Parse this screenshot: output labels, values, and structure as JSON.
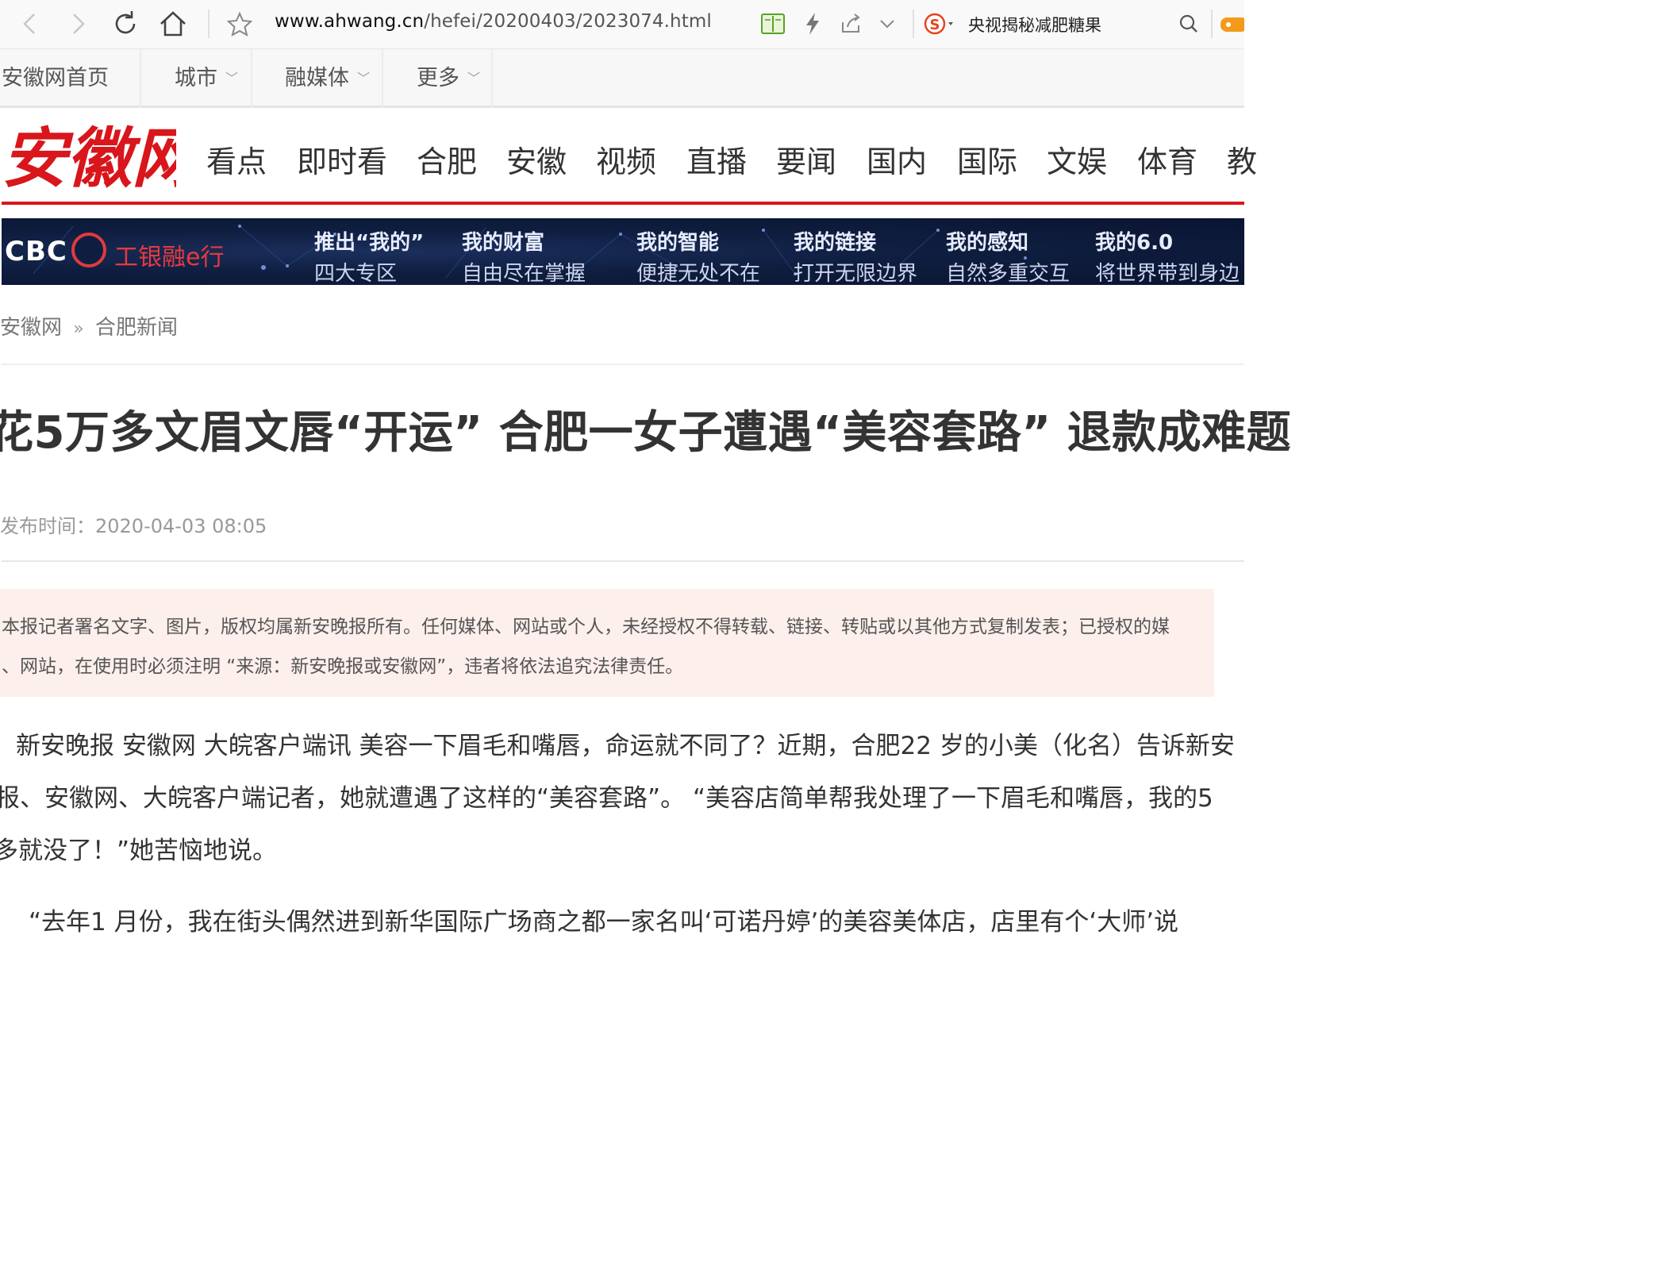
{
  "browser": {
    "url_host": "www.ahwang.cn",
    "url_path": "/hefei/20200403/2023074.html",
    "search_text": "央视揭秘减肥糖果"
  },
  "topnav": {
    "items": [
      {
        "label": "安徽网首页",
        "has_menu": false
      },
      {
        "label": "城市",
        "has_menu": true
      },
      {
        "label": "融媒体",
        "has_menu": true
      },
      {
        "label": "更多",
        "has_menu": true
      }
    ]
  },
  "header": {
    "logo_text": "安徽网",
    "channels": [
      "看点",
      "即时看",
      "合肥",
      "安徽",
      "视频",
      "直播",
      "要闻",
      "国内",
      "国际",
      "文娱",
      "体育",
      "教"
    ]
  },
  "banner": {
    "brand": "CBC",
    "bank": "工银融e行",
    "segments": [
      {
        "h": "推出“我的”",
        "s": "四大专区"
      },
      {
        "h": "我的财富",
        "s": "自由尽在掌握"
      },
      {
        "h": "我的智能",
        "s": "便捷无处不在"
      },
      {
        "h": "我的链接",
        "s": "打开无限边界"
      },
      {
        "h": "我的感知",
        "s": "自然多重交互"
      },
      {
        "h": "我的6.0",
        "s": "将世界带到身边"
      }
    ]
  },
  "breadcrumb": {
    "root": "安徽网",
    "separator": "»",
    "current": "合肥新闻"
  },
  "article": {
    "headline": "花5万多文眉文唇“开运” 合肥一女子遭遇“美容套路” 退款成难题",
    "pubtime": "发布时间：2020-04-03 08:05",
    "notice_line1": "本报记者署名文字、图片，版权均属新安晚报所有。任何媒体、网站或个人，未经授权不得转载、链接、转贴或以其他方式复制发表；已授权的媒",
    "notice_line2": "、网站，在使用时必须注明 “来源：新安晚报或安徽网”，违者将依法追究法律责任。",
    "para1_line1": "新安晚报 安徽网 大皖客户端讯 美容一下眉毛和嘴唇，命运就不同了？近期，合肥22 岁的小美（化名）告诉新安",
    "para1_line2": "报、安徽网、大皖客户端记者，她就遭遇了这样的“美容套路”。 “美容店简单帮我处理了一下眉毛和嘴唇，我的5",
    "para1_line3": "多就没了！”她苦恼地说。",
    "para2_line1": "“去年1 月份，我在街头偶然进到新华国际广场商之都一家名叫‘可诺丹婷’的美容美体店，店里有个‘大师’说"
  },
  "colors": {
    "brand_red": "#d8161b",
    "notice_bg": "#fdefec",
    "banner_bg": "#0f1e40"
  }
}
